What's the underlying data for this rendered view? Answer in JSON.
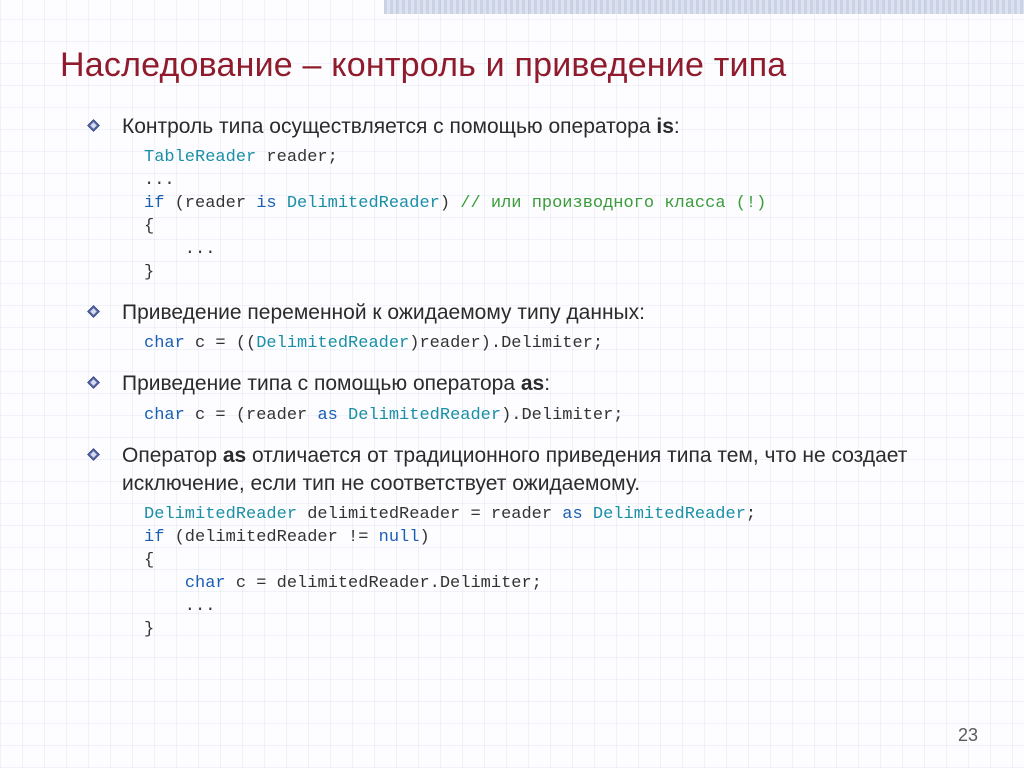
{
  "title": "Наследование – контроль и приведение типа",
  "bullets": {
    "b1_pre": "Контроль типа осуществляется с помощью оператора ",
    "b1_op": "is",
    "colon": ":",
    "b2": "Приведение переменной к ожидаемому типу данных:",
    "b3_pre": "Приведение типа с помощью оператора ",
    "b3_op": "as",
    "b4_pre": "Оператор ",
    "b4_op": "as",
    "b4_post": " отличается от традиционного приведения типа тем, что не создает исключение, если тип не соответствует ожидаемому."
  },
  "code": {
    "c1_l1_type": "TableReader",
    "c1_l1_rest": " reader;",
    "c1_l2": "...",
    "c1_l3_kw": "if",
    "c1_l3_mid1": " (reader ",
    "c1_l3_is": "is",
    "c1_l3_mid2": " ",
    "c1_l3_type": "DelimitedReader",
    "c1_l3_close": ") ",
    "c1_l3_cmt": "// или производного класса (!)",
    "c1_l4": "{",
    "c1_l5": "    ...",
    "c1_l6": "}",
    "c2_kw": "char",
    "c2_rest1": " c = ((",
    "c2_type": "DelimitedReader",
    "c2_rest2": ")reader).Delimiter;",
    "c3_kw": "char",
    "c3_rest1": " c = (reader ",
    "c3_as": "as",
    "c3_rest2": " ",
    "c3_type": "DelimitedReader",
    "c3_rest3": ").Delimiter;",
    "c4_l1_type": "DelimitedReader",
    "c4_l1_mid": " delimitedReader = reader ",
    "c4_l1_as": "as",
    "c4_l1_sp": " ",
    "c4_l1_type2": "DelimitedReader",
    "c4_l1_end": ";",
    "c4_l2_kw": "if",
    "c4_l2_mid": " (delimitedReader != ",
    "c4_l2_null": "null",
    "c4_l2_end": ")",
    "c4_l3": "{",
    "c4_l4_kw": "char",
    "c4_l4_rest": " c = delimitedReader.Delimiter;",
    "c4_l5": "    ...",
    "c4_l6": "}"
  },
  "pagenum": "23"
}
